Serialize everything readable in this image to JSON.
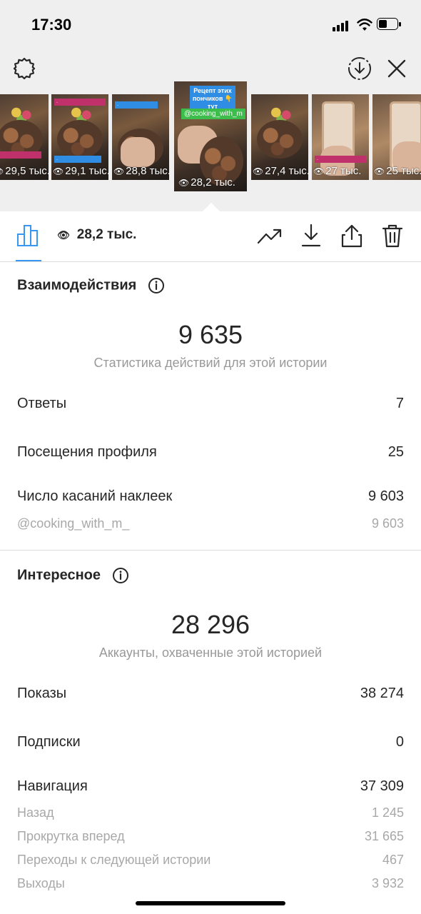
{
  "status_bar": {
    "time": "17:30"
  },
  "thumbnails": [
    {
      "views": "29,5 тыс."
    },
    {
      "views": "29,1 тыс."
    },
    {
      "views": "28,8 тыс."
    },
    {
      "views": "28,2 тыс.",
      "active": true,
      "caption": "Рецепт этих пончиков 👇 тут",
      "mention": "@cooking_with_m"
    },
    {
      "views": "27,4 тыс."
    },
    {
      "views": "27 тыс."
    },
    {
      "views": "25 тыс."
    }
  ],
  "toolbar": {
    "views": "28,2 тыс."
  },
  "interactions": {
    "title": "Взаимодействия",
    "total": "9 635",
    "caption": "Статистика действий для этой истории",
    "rows": [
      {
        "label": "Ответы",
        "value": "7"
      },
      {
        "label": "Посещения профиля",
        "value": "25"
      },
      {
        "label": "Число касаний наклеек",
        "value": "9 603"
      }
    ],
    "sub_rows": [
      {
        "label": "@cooking_with_m_",
        "value": "9 603"
      }
    ]
  },
  "discovery": {
    "title": "Интересное",
    "total": "28 296",
    "caption": "Аккаунты, охваченные этой историей",
    "rows": [
      {
        "label": "Показы",
        "value": "38 274"
      },
      {
        "label": "Подписки",
        "value": "0"
      },
      {
        "label": "Навигация",
        "value": "37 309"
      }
    ],
    "sub_rows": [
      {
        "label": "Назад",
        "value": "1 245"
      },
      {
        "label": "Прокрутка вперед",
        "value": "31 665"
      },
      {
        "label": "Переходы к следующей истории",
        "value": "467"
      },
      {
        "label": "Выходы",
        "value": "3 932"
      }
    ]
  },
  "colors": {
    "accent": "#3897f0",
    "text": "#262626",
    "muted": "#999999",
    "top_bg": "#efefef"
  }
}
